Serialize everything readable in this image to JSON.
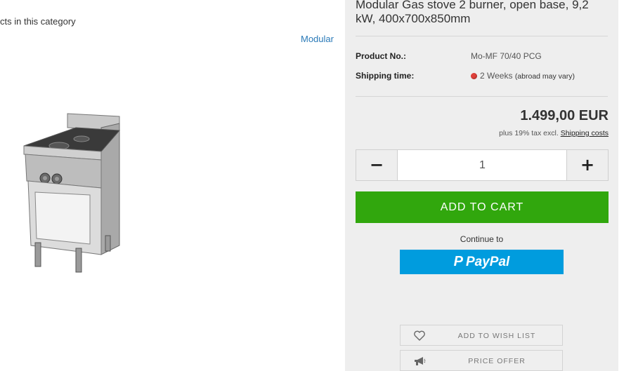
{
  "category": {
    "products_text": "cts in this category",
    "brand_link": "Modular"
  },
  "product": {
    "title": "Modular Gas stove 2 burner, open base, 9,2 kW, 400x700x850mm",
    "product_no_label": "Product No.:",
    "product_no_value": "Mo-MF 70/40 PCG",
    "shipping_label": "Shipping time:",
    "shipping_value": "2 Weeks",
    "shipping_note": "(abroad may vary)",
    "shipping_status_color": "#e0403a",
    "price": "1.499,00 EUR",
    "tax_text": "plus 19% tax excl.",
    "shipping_costs_link": "Shipping costs"
  },
  "quantity": {
    "minus_label": "−",
    "value": "1",
    "plus_label": "+"
  },
  "actions": {
    "add_to_cart": "ADD TO CART",
    "add_to_cart_color": "#31a70d",
    "continue_to": "Continue to",
    "paypal_label": "PayPal",
    "paypal_color": "#009cde",
    "wishlist_label": "ADD TO WISH LIST",
    "wishlist_icon": "heart-icon",
    "price_offer_label": "PRICE OFFER",
    "price_offer_icon": "megaphone-icon"
  }
}
